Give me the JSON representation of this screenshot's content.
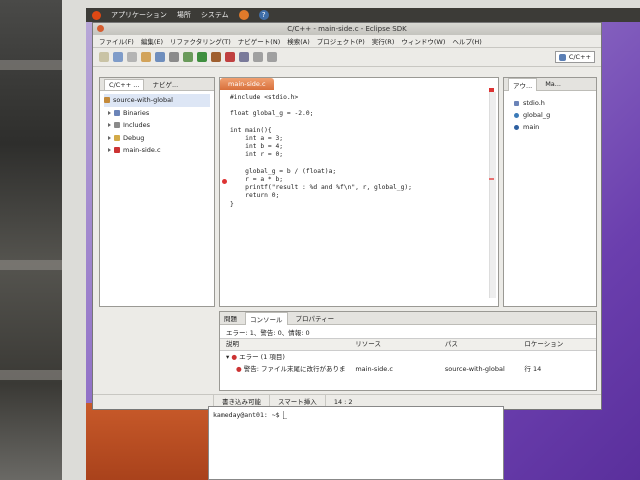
{
  "panel": {
    "apps": "アプリケーション",
    "places": "場所",
    "system": "システム"
  },
  "window": {
    "title": "C/C++ - main-side.c - Eclipse SDK"
  },
  "menu": [
    "ファイル(F)",
    "編集(E)",
    "リファクタリング(T)",
    "ナビゲート(N)",
    "検索(A)",
    "プロジェクト(P)",
    "実行(R)",
    "ウィンドウ(W)",
    "ヘルプ(H)"
  ],
  "perspective": "C/C++",
  "left_tabs": [
    "C/C++ ...",
    "ナビゲ..."
  ],
  "tree": {
    "root": "source-with-global",
    "items": [
      "Binaries",
      "Includes",
      "Debug",
      "main-side.c"
    ]
  },
  "editor": {
    "tab": "main-side.c",
    "code": [
      "#include <stdio.h>",
      "",
      "float global_g = -2.0;",
      "",
      "int main(){",
      "    int a = 3;",
      "    int b = 4;",
      "    int r = 0;",
      "",
      "    global_g = b / (float)a;",
      "    r = a * b;",
      "    printf(\"result : %d and %f\\n\", r, global_g);",
      "    return 0;",
      "}"
    ]
  },
  "outline": {
    "tabs": [
      "アウ...",
      "Ma..."
    ],
    "items": [
      "stdio.h",
      "global_g",
      "main"
    ]
  },
  "problems": {
    "tabs": [
      "問題",
      "コンソール",
      "プロパティー"
    ],
    "summary": "エラー: 1、警告: 0、情報: 0",
    "columns": [
      "説明",
      "リソース",
      "パス",
      "ロケーション"
    ],
    "group": "エラー (1 項目)",
    "row": {
      "desc": "警告: ファイル末尾に改行がありま",
      "resource": "main-side.c",
      "path": "source-with-global",
      "location": "行 14"
    }
  },
  "status": {
    "writable": "書き込み可能",
    "insert": "スマート挿入",
    "position": "14 : 2"
  },
  "terminal": {
    "prompt": "kameday@ant01: ~$ "
  }
}
